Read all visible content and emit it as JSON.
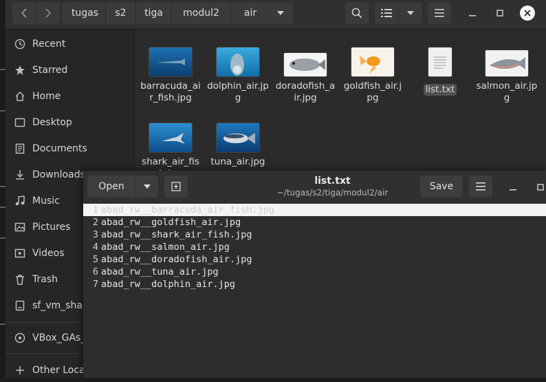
{
  "breadcrumbs": [
    "tugas",
    "s2",
    "tiga",
    "modul2",
    "air"
  ],
  "sidebar": {
    "items": [
      {
        "label": "Recent",
        "icon": "clock-icon"
      },
      {
        "label": "Starred",
        "icon": "star-icon"
      },
      {
        "label": "Home",
        "icon": "home-icon"
      },
      {
        "label": "Desktop",
        "icon": "desktop-icon"
      },
      {
        "label": "Documents",
        "icon": "document-icon"
      },
      {
        "label": "Downloads",
        "icon": "download-icon"
      },
      {
        "label": "Music",
        "icon": "music-icon"
      },
      {
        "label": "Pictures",
        "icon": "pictures-icon"
      },
      {
        "label": "Videos",
        "icon": "video-icon"
      },
      {
        "label": "Trash",
        "icon": "trash-icon"
      },
      {
        "label": "sf_vm_shar",
        "icon": "drive-icon"
      },
      {
        "label": "VBox_GAs_",
        "icon": "disc-icon"
      },
      {
        "label": "Other Locat",
        "icon": "plus-icon"
      }
    ]
  },
  "files": [
    {
      "name": "barracuda_air_fish.jpg"
    },
    {
      "name": "dolphin_air.jpg"
    },
    {
      "name": "doradofish_air.jpg"
    },
    {
      "name": "goldfish_air.jpg"
    },
    {
      "name": "list.txt"
    },
    {
      "name": "salmon_air.jpg"
    },
    {
      "name": "shark_air_fish.jpg"
    },
    {
      "name": "tuna_air.jpg"
    }
  ],
  "editor": {
    "open_label": "Open",
    "save_label": "Save",
    "title": "list.txt",
    "path": "~/tugas/s2/tiga/modul2/air",
    "lines": [
      "abad_rw__barracuda_air_fish.jpg",
      "abad_rw__goldfish_air.jpg",
      "abad_rw__shark_air_fish.jpg",
      "abad_rw__salmon_air.jpg",
      "abad_rw__doradofish_air.jpg",
      "abad_rw__tuna_air.jpg",
      "abad_rw__dolphin_air.jpg"
    ],
    "line_numbers": [
      "1",
      "2",
      "3",
      "4",
      "5",
      "6",
      "7"
    ]
  },
  "colors": {
    "accent_close": "#f5f5f5",
    "selection_bg": "#505050",
    "current_line": "#f4f4f4"
  }
}
